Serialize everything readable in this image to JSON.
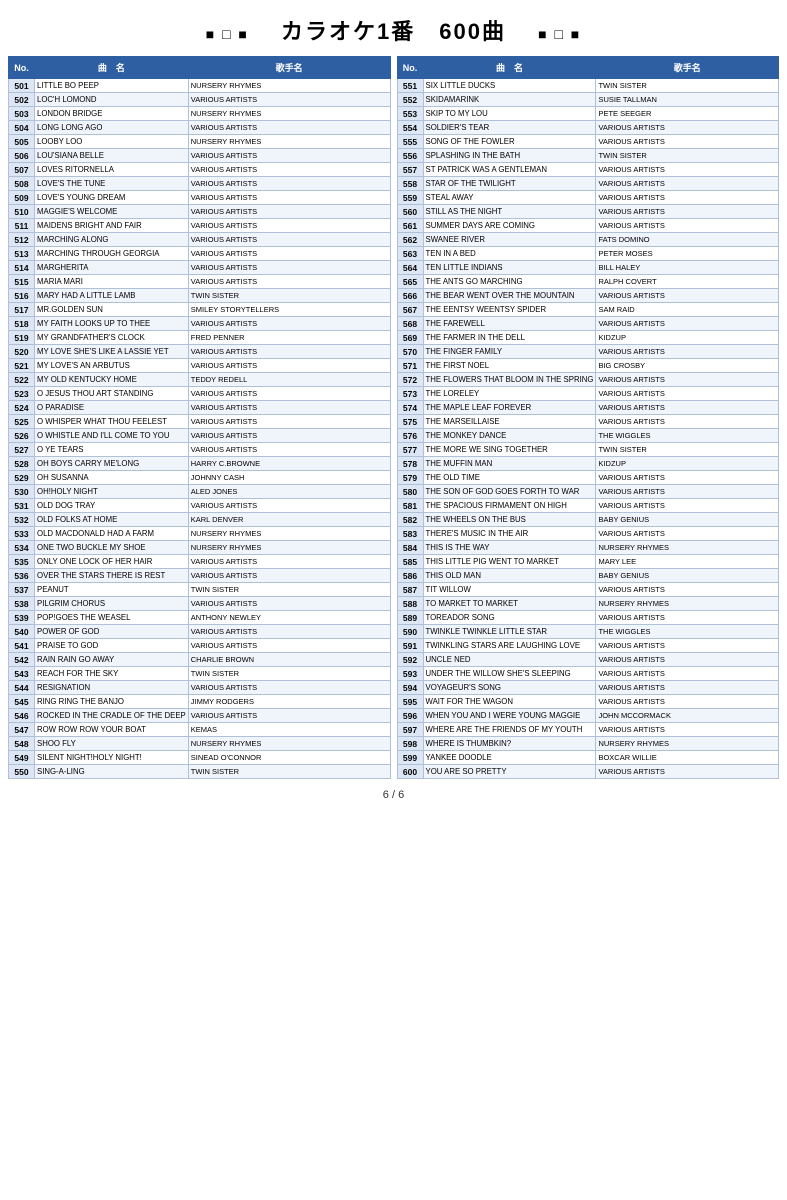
{
  "header": {
    "title": "カラオケ1番　600曲",
    "symbols_left": "■ □ ■",
    "symbols_right": "■ □ ■"
  },
  "footer": {
    "page": "6 / 6"
  },
  "left_table": {
    "columns": [
      "No.",
      "曲　名",
      "歌手名"
    ],
    "rows": [
      [
        "501",
        "LITTLE BO PEEP",
        "NURSERY RHYMES"
      ],
      [
        "502",
        "LOC'H LOMOND",
        "VARIOUS ARTISTS"
      ],
      [
        "503",
        "LONDON BRIDGE",
        "NURSERY RHYMES"
      ],
      [
        "504",
        "LONG LONG AGO",
        "VARIOUS ARTISTS"
      ],
      [
        "505",
        "LOOBY LOO",
        "NURSERY RHYMES"
      ],
      [
        "506",
        "LOU'SIANA BELLE",
        "VARIOUS ARTISTS"
      ],
      [
        "507",
        "LOVES RITORNELLA",
        "VARIOUS ARTISTS"
      ],
      [
        "508",
        "LOVE'S THE TUNE",
        "VARIOUS ARTISTS"
      ],
      [
        "509",
        "LOVE'S YOUNG DREAM",
        "VARIOUS ARTISTS"
      ],
      [
        "510",
        "MAGGIE'S WELCOME",
        "VARIOUS ARTISTS"
      ],
      [
        "511",
        "MAIDENS BRIGHT AND FAIR",
        "VARIOUS ARTISTS"
      ],
      [
        "512",
        "MARCHING ALONG",
        "VARIOUS ARTISTS"
      ],
      [
        "513",
        "MARCHING THROUGH GEORGIA",
        "VARIOUS ARTISTS"
      ],
      [
        "514",
        "MARGHERITA",
        "VARIOUS ARTISTS"
      ],
      [
        "515",
        "MARIA MARI",
        "VARIOUS ARTISTS"
      ],
      [
        "516",
        "MARY HAD A LITTLE LAMB",
        "TWIN SISTER"
      ],
      [
        "517",
        "MR.GOLDEN SUN",
        "SMILEY STORYTELLERS"
      ],
      [
        "518",
        "MY FAITH LOOKS UP TO THEE",
        "VARIOUS ARTISTS"
      ],
      [
        "519",
        "MY GRANDFATHER'S CLOCK",
        "FRED PENNER"
      ],
      [
        "520",
        "MY LOVE SHE'S LIKE A LASSIE YET",
        "VARIOUS ARTISTS"
      ],
      [
        "521",
        "MY LOVE'S AN ARBUTUS",
        "VARIOUS ARTISTS"
      ],
      [
        "522",
        "MY OLD KENTUCKY HOME",
        "TEDDY REDELL"
      ],
      [
        "523",
        "O JESUS THOU ART STANDING",
        "VARIOUS ARTISTS"
      ],
      [
        "524",
        "O PARADISE",
        "VARIOUS ARTISTS"
      ],
      [
        "525",
        "O WHISPER WHAT THOU FEELEST",
        "VARIOUS ARTISTS"
      ],
      [
        "526",
        "O WHISTLE AND I'LL COME TO YOU",
        "VARIOUS ARTISTS"
      ],
      [
        "527",
        "O YE TEARS",
        "VARIOUS ARTISTS"
      ],
      [
        "528",
        "OH BOYS CARRY ME'LONG",
        "HARRY C.BROWNE"
      ],
      [
        "529",
        "OH SUSANNA",
        "JOHNNY CASH"
      ],
      [
        "530",
        "OH!HOLY NIGHT",
        "ALED JONES"
      ],
      [
        "531",
        "OLD DOG TRAY",
        "VARIOUS ARTISTS"
      ],
      [
        "532",
        "OLD FOLKS AT HOME",
        "KARL DENVER"
      ],
      [
        "533",
        "OLD MACDONALD HAD A FARM",
        "NURSERY RHYMES"
      ],
      [
        "534",
        "ONE TWO BUCKLE MY SHOE",
        "NURSERY RHYMES"
      ],
      [
        "535",
        "ONLY ONE LOCK OF HER HAIR",
        "VARIOUS ARTISTS"
      ],
      [
        "536",
        "OVER THE STARS THERE IS REST",
        "VARIOUS ARTISTS"
      ],
      [
        "537",
        "PEANUT",
        "TWIN SISTER"
      ],
      [
        "538",
        "PILGRIM CHORUS",
        "VARIOUS ARTISTS"
      ],
      [
        "539",
        "POP!GOES THE WEASEL",
        "ANTHONY NEWLEY"
      ],
      [
        "540",
        "POWER OF GOD",
        "VARIOUS ARTISTS"
      ],
      [
        "541",
        "PRAISE TO GOD",
        "VARIOUS ARTISTS"
      ],
      [
        "542",
        "RAIN RAIN GO AWAY",
        "CHARLIE BROWN"
      ],
      [
        "543",
        "REACH FOR THE SKY",
        "TWIN SISTER"
      ],
      [
        "544",
        "RESIGNATION",
        "VARIOUS ARTISTS"
      ],
      [
        "545",
        "RING RING THE BANJO",
        "JIMMY RODGERS"
      ],
      [
        "546",
        "ROCKED IN THE CRADLE OF THE DEEP",
        "VARIOUS ARTISTS"
      ],
      [
        "547",
        "ROW ROW ROW YOUR BOAT",
        "KEMAS"
      ],
      [
        "548",
        "SHOO FLY",
        "NURSERY RHYMES"
      ],
      [
        "549",
        "SILENT NIGHT!HOLY NIGHT!",
        "SINEAD O'CONNOR"
      ],
      [
        "550",
        "SING-A-LING",
        "TWIN SISTER"
      ]
    ]
  },
  "right_table": {
    "columns": [
      "No.",
      "曲　名",
      "歌手名"
    ],
    "rows": [
      [
        "551",
        "SIX LITTLE DUCKS",
        "TWIN SISTER"
      ],
      [
        "552",
        "SKIDAMARINK",
        "SUSIE TALLMAN"
      ],
      [
        "553",
        "SKIP TO MY LOU",
        "PETE SEEGER"
      ],
      [
        "554",
        "SOLDIER'S TEAR",
        "VARIOUS ARTISTS"
      ],
      [
        "555",
        "SONG OF THE FOWLER",
        "VARIOUS ARTISTS"
      ],
      [
        "556",
        "SPLASHING IN THE BATH",
        "TWIN SISTER"
      ],
      [
        "557",
        "ST PATRICK WAS A GENTLEMAN",
        "VARIOUS ARTISTS"
      ],
      [
        "558",
        "STAR OF THE TWILIGHT",
        "VARIOUS ARTISTS"
      ],
      [
        "559",
        "STEAL AWAY",
        "VARIOUS ARTISTS"
      ],
      [
        "560",
        "STILL AS THE NIGHT",
        "VARIOUS ARTISTS"
      ],
      [
        "561",
        "SUMMER DAYS ARE COMING",
        "VARIOUS ARTISTS"
      ],
      [
        "562",
        "SWANEE RIVER",
        "FATS DOMINO"
      ],
      [
        "563",
        "TEN IN A BED",
        "PETER MOSES"
      ],
      [
        "564",
        "TEN LITTLE INDIANS",
        "BILL HALEY"
      ],
      [
        "565",
        "THE ANTS GO MARCHING",
        "RALPH COVERT"
      ],
      [
        "566",
        "THE BEAR WENT OVER THE MOUNTAIN",
        "VARIOUS ARTISTS"
      ],
      [
        "567",
        "THE EENTSY WEENTSY SPIDER",
        "SAM RAID"
      ],
      [
        "568",
        "THE FAREWELL",
        "VARIOUS ARTISTS"
      ],
      [
        "569",
        "THE FARMER IN THE DELL",
        "KIDZUP"
      ],
      [
        "570",
        "THE FINGER FAMILY",
        "VARIOUS ARTISTS"
      ],
      [
        "571",
        "THE FIRST NOEL",
        "BIG CROSBY"
      ],
      [
        "572",
        "THE FLOWERS THAT BLOOM IN THE SPRING",
        "VARIOUS ARTISTS"
      ],
      [
        "573",
        "THE LORELEY",
        "VARIOUS ARTISTS"
      ],
      [
        "574",
        "THE MAPLE LEAF FOREVER",
        "VARIOUS ARTISTS"
      ],
      [
        "575",
        "THE MARSEILLAISE",
        "VARIOUS ARTISTS"
      ],
      [
        "576",
        "THE MONKEY DANCE",
        "THE WIGGLES"
      ],
      [
        "577",
        "THE MORE WE SING TOGETHER",
        "TWIN SISTER"
      ],
      [
        "578",
        "THE MUFFIN MAN",
        "KIDZUP"
      ],
      [
        "579",
        "THE OLD TIME",
        "VARIOUS ARTISTS"
      ],
      [
        "580",
        "THE SON OF GOD GOES FORTH TO WAR",
        "VARIOUS ARTISTS"
      ],
      [
        "581",
        "THE SPACIOUS FIRMAMENT ON HIGH",
        "VARIOUS ARTISTS"
      ],
      [
        "582",
        "THE WHEELS ON THE BUS",
        "BABY GENIUS"
      ],
      [
        "583",
        "THERE'S MUSIC IN THE AIR",
        "VARIOUS ARTISTS"
      ],
      [
        "584",
        "THIS IS THE WAY",
        "NURSERY RHYMES"
      ],
      [
        "585",
        "THIS LITTLE PIG WENT TO MARKET",
        "MARY LEE"
      ],
      [
        "586",
        "THIS OLD MAN",
        "BABY GENIUS"
      ],
      [
        "587",
        "TIT WILLOW",
        "VARIOUS ARTISTS"
      ],
      [
        "588",
        "TO MARKET TO MARKET",
        "NURSERY RHYMES"
      ],
      [
        "589",
        "TOREADOR SONG",
        "VARIOUS ARTISTS"
      ],
      [
        "590",
        "TWINKLE TWINKLE LITTLE  STAR",
        "THE  WIGGLES"
      ],
      [
        "591",
        "TWINKLING STARS ARE LAUGHING LOVE",
        "VARIOUS ARTISTS"
      ],
      [
        "592",
        "UNCLE NED",
        "VARIOUS ARTISTS"
      ],
      [
        "593",
        "UNDER THE WILLOW SHE'S SLEEPING",
        "VARIOUS ARTISTS"
      ],
      [
        "594",
        "VOYAGEUR'S SONG",
        "VARIOUS ARTISTS"
      ],
      [
        "595",
        "WAIT FOR THE WAGON",
        "VARIOUS ARTISTS"
      ],
      [
        "596",
        "WHEN YOU AND I WERE YOUNG MAGGIE",
        "JOHN MCCORMACK"
      ],
      [
        "597",
        "WHERE ARE THE FRIENDS OF MY YOUTH",
        "VARIOUS ARTISTS"
      ],
      [
        "598",
        "WHERE IS THUMBKIN?",
        "NURSERY RHYMES"
      ],
      [
        "599",
        "YANKEE DOODLE",
        "BOXCAR WILLIE"
      ],
      [
        "600",
        "YOU ARE SO PRETTY",
        "VARIOUS ARTISTS"
      ]
    ]
  }
}
